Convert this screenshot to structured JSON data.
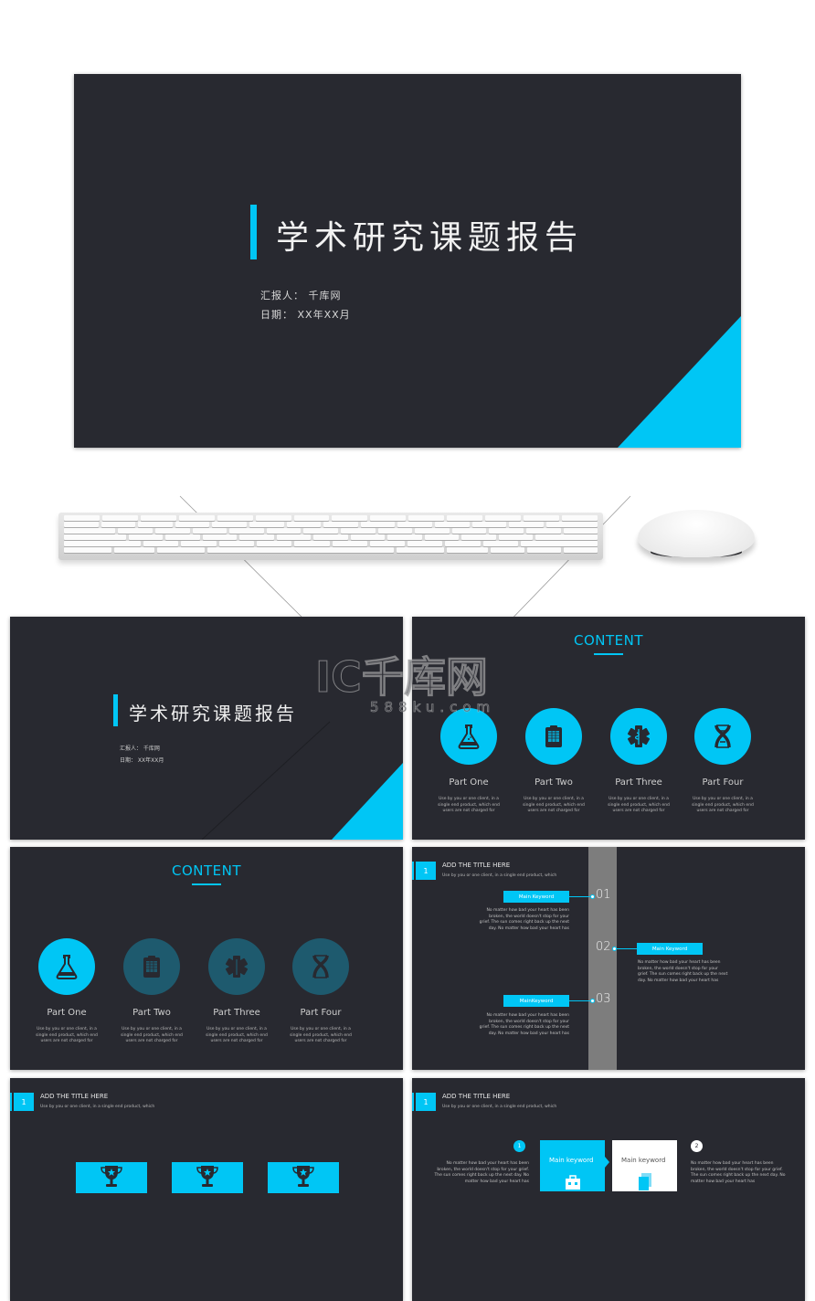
{
  "colors": {
    "slide_bg": "#282930",
    "accent": "#00c6f5",
    "dim_accent": "#1e5a6e",
    "timeline_bar": "#7d7d7d",
    "page_bg": "#ffffff"
  },
  "cover": {
    "title": "学术研究课题报告",
    "reporter": "汇报人：  千库网",
    "date": "日期：  XX年XX月"
  },
  "watermark": {
    "logo": "IC千库网",
    "url": "588ku.com"
  },
  "content_slide": {
    "title": "CONTENT",
    "parts": [
      {
        "label": "Part One",
        "icon": "flask-icon",
        "desc": "Use by you or one client, in a single end product, which end users are not charged for"
      },
      {
        "label": "Part Two",
        "icon": "clipboard-icon",
        "desc": "Use by you or one client, in a single end product, which end users are not charged for"
      },
      {
        "label": "Part Three",
        "icon": "medical-star-icon",
        "desc": "Use by you or one client, in a single end product, which end users are not charged for"
      },
      {
        "label": "Part Four",
        "icon": "dna-icon",
        "desc": "Use by you or one client, in a single end product, which end users are not charged for"
      }
    ]
  },
  "section_header": {
    "number": "1",
    "title": "ADD THE TITLE HERE",
    "subtitle": "Use by you or one client, in a single end product, which"
  },
  "timeline_slide": {
    "items": [
      {
        "num": "01",
        "keyword": "Main Keyword",
        "desc": "No matter how bad your heart has been broken, the world doesn't stop for your grief. The sun comes right back up the next day. No matter how bad your heart has"
      },
      {
        "num": "02",
        "keyword": "Main Keyword",
        "desc": "No matter how bad your heart has been broken, the world doesn't stop for your grief. The sun comes right back up the next day. No matter how bad your heart has"
      },
      {
        "num": "03",
        "keyword": "MainKeyword",
        "desc": "No matter how bad your heart has been broken, the world doesn't stop for your grief. The sun comes right back up the next day. No matter how bad your heart has"
      }
    ]
  },
  "trophy_slide": {
    "items": [
      {
        "icon": "trophy-icon"
      },
      {
        "icon": "trophy-icon"
      },
      {
        "icon": "trophy-icon"
      }
    ]
  },
  "keyword_slide": {
    "step1": "1",
    "step2": "2",
    "box1_label": "Main keyword",
    "box2_label": "Main keyword",
    "left_desc": "No matter how bad your heart has been broken, the world doesn't stop for your grief. The sun comes right back up the next day. No matter how bad your heart has",
    "right_desc": "No matter how bad your heart has been broken, the world doesn't stop for your grief. The sun comes right back up the next day. No matter how bad your heart has"
  }
}
